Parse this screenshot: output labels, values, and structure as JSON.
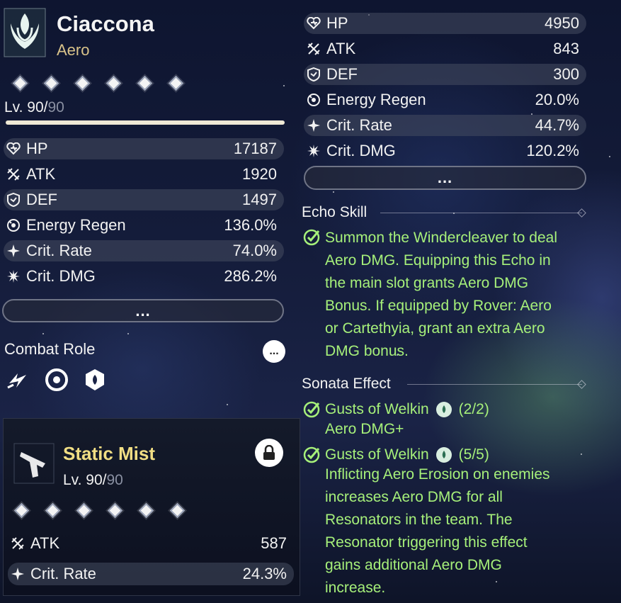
{
  "character": {
    "name": "Ciaccona",
    "element": "Aero",
    "level_current": "Lv. 90/",
    "level_max": "90",
    "level_progress": 1.0,
    "stats": [
      {
        "icon": "hp-icon",
        "label": "HP",
        "value": "17187"
      },
      {
        "icon": "atk-icon",
        "label": "ATK",
        "value": "1920"
      },
      {
        "icon": "def-icon",
        "label": "DEF",
        "value": "1497"
      },
      {
        "icon": "energy-regen-icon",
        "label": "Energy Regen",
        "value": "136.0%"
      },
      {
        "icon": "crit-rate-icon",
        "label": "Crit. Rate",
        "value": "74.0%"
      },
      {
        "icon": "crit-dmg-icon",
        "label": "Crit. DMG",
        "value": "286.2%"
      }
    ],
    "more_label": "...",
    "combat_role_title": "Combat Role",
    "combat_more_label": "...",
    "role_icons": [
      "lightning-icon",
      "swirl-icon",
      "shield-emblem-icon"
    ]
  },
  "weapon": {
    "name": "Static Mist",
    "level_current": "Lv. 90/",
    "level_max": "90",
    "stats": [
      {
        "icon": "atk-icon",
        "label": "ATK",
        "value": "587"
      },
      {
        "icon": "crit-rate-icon",
        "label": "Crit. Rate",
        "value": "24.3%"
      }
    ]
  },
  "echo": {
    "stats": [
      {
        "icon": "hp-icon",
        "label": "HP",
        "value": "4950"
      },
      {
        "icon": "atk-icon",
        "label": "ATK",
        "value": "843"
      },
      {
        "icon": "def-icon",
        "label": "DEF",
        "value": "300"
      },
      {
        "icon": "energy-regen-icon",
        "label": "Energy Regen",
        "value": "20.0%"
      },
      {
        "icon": "crit-rate-icon",
        "label": "Crit. Rate",
        "value": "44.7%"
      },
      {
        "icon": "crit-dmg-icon",
        "label": "Crit. DMG",
        "value": "120.2%"
      }
    ],
    "more_label": "...",
    "skill_title": "Echo Skill",
    "skill_lines": [
      "Summon the Windercleaver to deal",
      "Aero DMG. Equipping this Echo in",
      "the main slot grants Aero DMG",
      "Bonus. If equipped by Rover: Aero",
      "or Cartethyia, grant an extra Aero",
      "DMG bonus."
    ],
    "sonata_title": "Sonata Effect",
    "sonata_effects": [
      {
        "name": "Gusts of Welkin",
        "count": "(2/2)",
        "lines": [
          "Aero DMG+"
        ]
      },
      {
        "name": "Gusts of Welkin",
        "count": "(5/5)",
        "lines": [
          "Inflicting Aero Erosion on enemies",
          "increases Aero DMG for all",
          "Resonators in the team. The",
          "Resonator triggering this effect",
          "gains additional Aero DMG",
          "increase."
        ]
      }
    ]
  },
  "colors": {
    "element_gold": "#d9c38a",
    "weapon_gold": "#f1de84",
    "effect_green": "#a6f07a"
  }
}
